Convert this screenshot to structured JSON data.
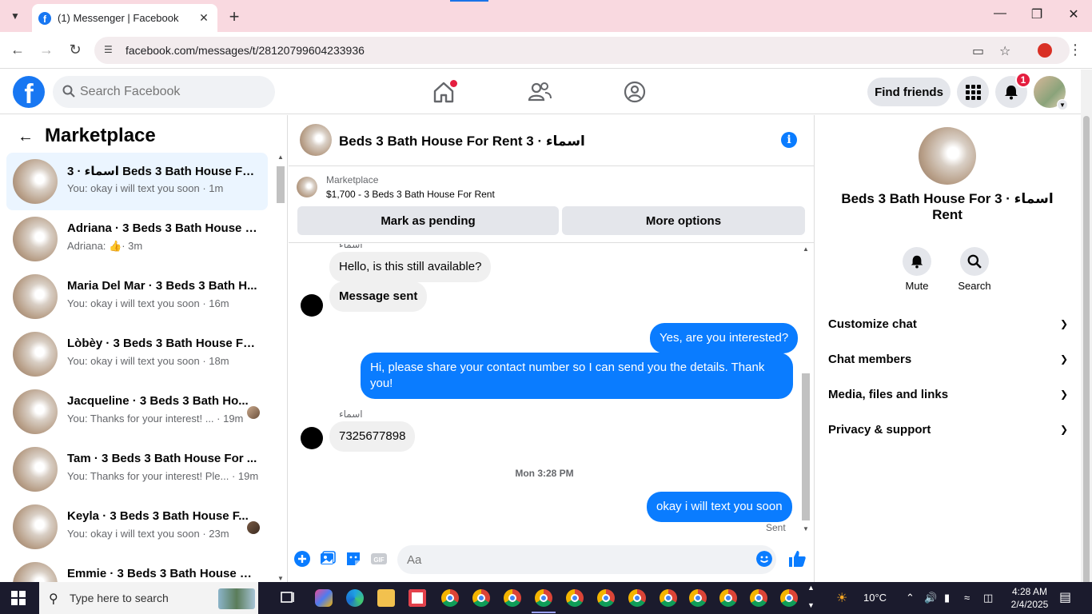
{
  "browser": {
    "tab_title": "(1) Messenger | Facebook",
    "url": "facebook.com/messages/t/28120799604233936"
  },
  "header": {
    "search_placeholder": "Search Facebook",
    "find_friends": "Find friends",
    "notification_count": "1"
  },
  "marketplace": {
    "title": "Marketplace",
    "conversations": [
      {
        "name": "اسماء · 3 Beds 3 Bath House For Rent ...",
        "preview": "You: okay i will text you soon · 1m",
        "active": true
      },
      {
        "name": "Adriana · 3 Beds 3 Bath House F...",
        "preview": "Adriana:",
        "time": "· 3m"
      },
      {
        "name": "Maria Del Mar · 3 Beds 3 Bath H...",
        "preview": "You: okay i will text you soon · 16m"
      },
      {
        "name": "Lòbèy · 3 Beds 3 Bath House Fo...",
        "preview": "You: okay i will text you soon · 18m"
      },
      {
        "name": "Jacqueline · 3 Beds 3 Bath Ho...",
        "preview": "You: Thanks for your interest! ...  · 19m"
      },
      {
        "name": "Tam · 3 Beds 3 Bath House For ...",
        "preview": "You: Thanks for your interest! Ple... · 19m"
      },
      {
        "name": "Keyla · 3 Beds 3 Bath House F...",
        "preview": "You: okay i will text you soon · 23m"
      },
      {
        "name": "Emmie · 3 Beds 3 Bath House Fo...",
        "preview": ""
      }
    ]
  },
  "chat": {
    "title": "اسماء · 3 Beds 3 Bath House For Rent",
    "marketplace_label": "Marketplace",
    "listing": "$1,700 - 3 Beds 3 Bath House For Rent",
    "mark_pending": "Mark as pending",
    "more_options": "More options",
    "sender_top": "اسماء",
    "messages": {
      "m1": "Hello, is this still available?",
      "m2": "Message sent",
      "m3": "Yes, are you interested?",
      "m4": "Hi, please share your contact number so I can send you the details. Thank you!",
      "sender2": "اسماء",
      "m5": "7325677898",
      "timestamp": "Mon 3:28 PM",
      "m6": "okay i will text you soon",
      "status": "Sent"
    },
    "composer_placeholder": "Aa"
  },
  "details": {
    "name": "اسماء · 3 Beds 3 Bath House For Rent",
    "mute": "Mute",
    "search": "Search",
    "sections": [
      "Customize chat",
      "Chat members",
      "Media, files and links",
      "Privacy & support"
    ]
  },
  "taskbar": {
    "search_text": "Type here to search",
    "weather": "10°C",
    "time": "4:28 AM",
    "date": "2/4/2025"
  }
}
